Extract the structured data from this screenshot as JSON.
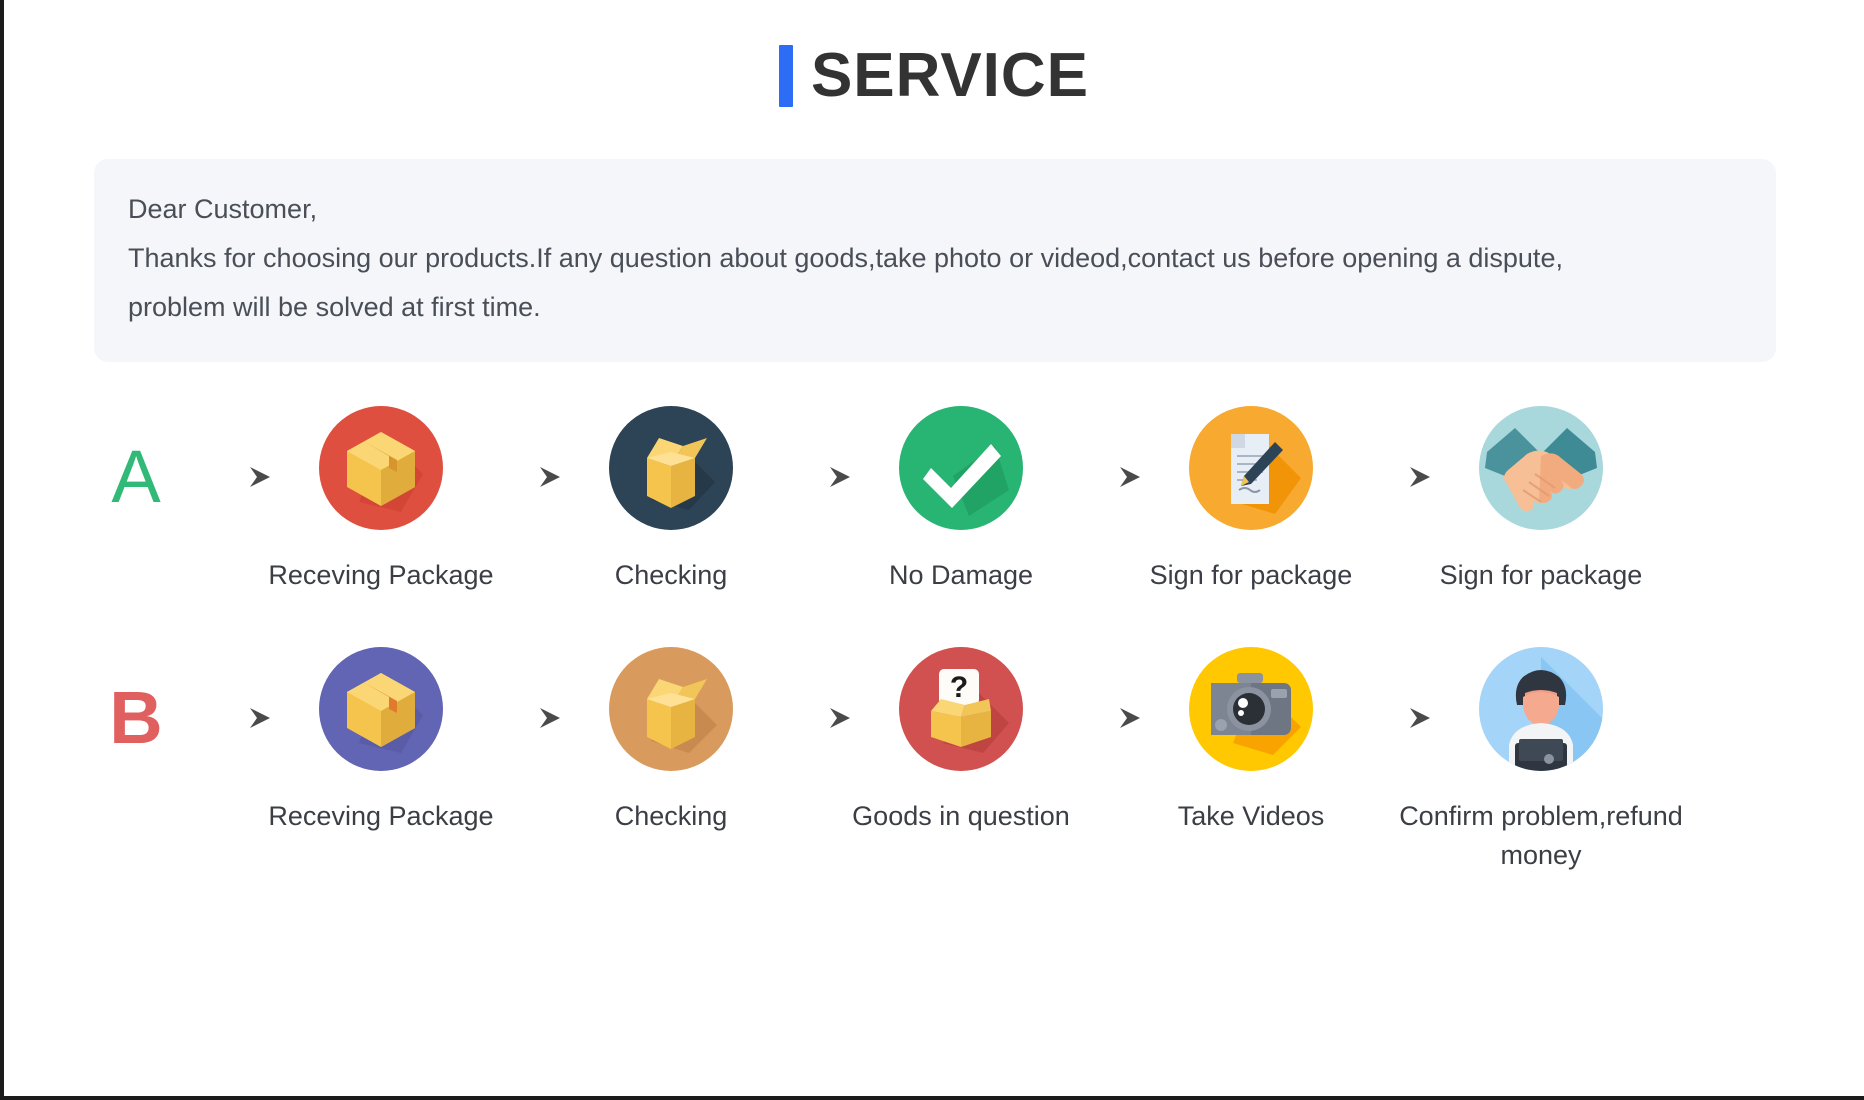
{
  "page": {
    "title": "SERVICE",
    "accent_color": "#2d6cf5",
    "title_color": "#333333",
    "background": "#ffffff"
  },
  "notice": {
    "background": "#f4f6fa",
    "line1": "Dear Customer,",
    "line2": "Thanks for choosing our products.If any question about goods,take photo or videod,contact us before opening a dispute,",
    "line3": "problem will be solved at first time."
  },
  "flows": [
    {
      "badge": "A",
      "badge_color": "#31b978",
      "steps": [
        {
          "label": "Receving Package",
          "icon": "package-box-icon",
          "circle_color": "#df4f3f"
        },
        {
          "label": "Checking",
          "icon": "open-box-icon",
          "circle_color": "#2d4356"
        },
        {
          "label": "No Damage",
          "icon": "check-mark-icon",
          "circle_color": "#28b473"
        },
        {
          "label": "Sign for package",
          "icon": "document-pen-icon",
          "circle_color": "#f7a930"
        },
        {
          "label": "Sign for package",
          "icon": "handshake-icon",
          "circle_color": "#a8d8dc"
        }
      ]
    },
    {
      "badge": "B",
      "badge_color": "#e0605f",
      "steps": [
        {
          "label": "Receving Package",
          "icon": "package-box-icon",
          "circle_color": "#6264b4"
        },
        {
          "label": "Checking",
          "icon": "open-box-icon",
          "circle_color": "#d99a5e"
        },
        {
          "label": "Goods in question",
          "icon": "question-box-icon",
          "circle_color": "#d0514f"
        },
        {
          "label": "Take Videos",
          "icon": "camera-icon",
          "circle_color": "#ffc801"
        },
        {
          "label": "Confirm problem,refund money",
          "icon": "support-person-icon",
          "circle_color": "#a4d4f7"
        }
      ]
    }
  ],
  "arrow": {
    "icon": "arrow-right-icon",
    "color": "#555555"
  }
}
